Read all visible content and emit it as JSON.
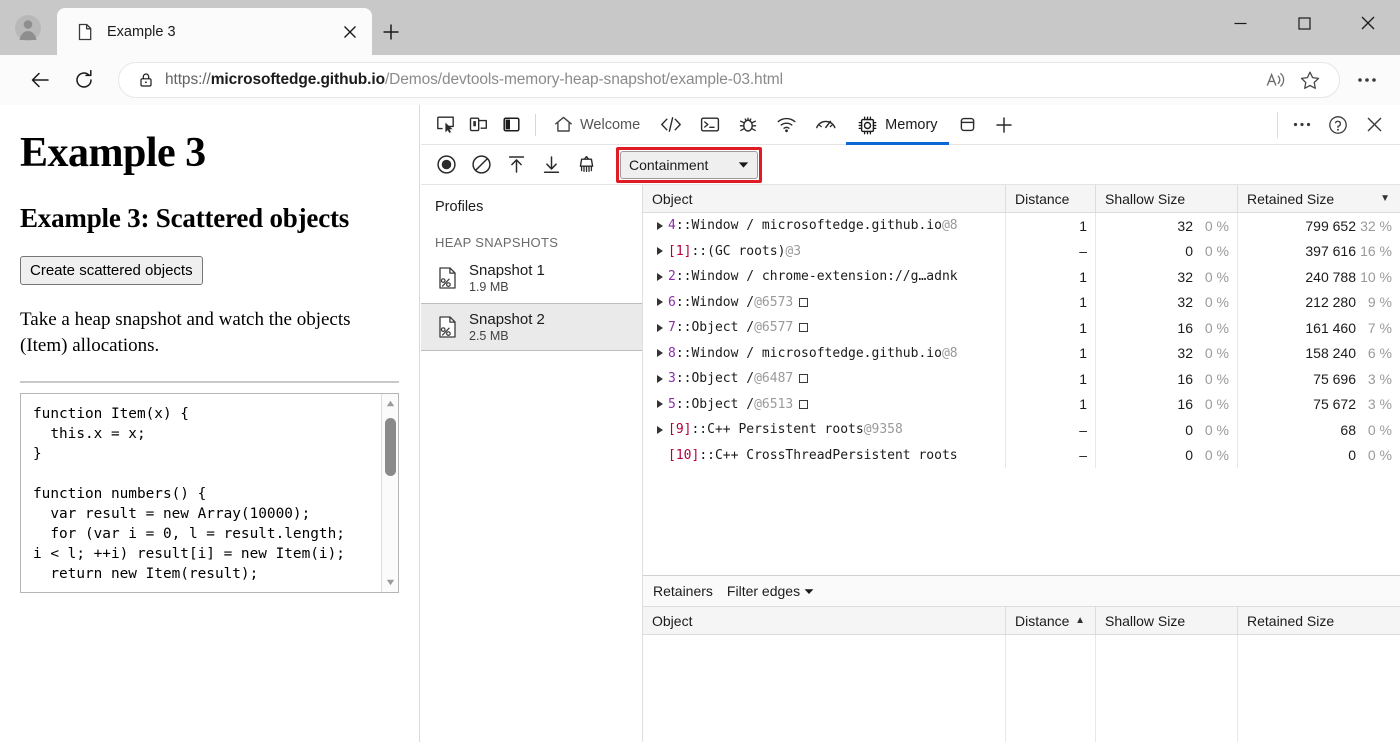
{
  "browser": {
    "tab": {
      "title": "Example 3",
      "favicon_icon": "document-icon",
      "close_icon": "close-icon"
    },
    "new_tab_icon": "plus-icon",
    "profile_icon": "account-avatar-icon",
    "window_controls": {
      "minimize": "minimize-icon",
      "maximize": "maximize-icon",
      "close": "close-icon"
    },
    "nav": {
      "back_icon": "arrow-left-icon",
      "reload_icon": "reload-icon"
    },
    "omnibox": {
      "lock_icon": "lock-icon",
      "scheme": "https://",
      "host": "microsoftedge.github.io",
      "path": "/Demos/devtools-memory-heap-snapshot/example-03.html",
      "read_aloud_icon": "read-aloud-icon",
      "favorite_icon": "star-icon"
    },
    "settings_icon": "ellipsis-icon"
  },
  "page": {
    "h1": "Example 3",
    "h2": "Example 3: Scattered objects",
    "button_label": "Create scattered objects",
    "paragraph": "Take a heap snapshot and watch the objects (Item) allocations.",
    "code": "function Item(x) {\n  this.x = x;\n}\n\nfunction numbers() {\n  var result = new Array(10000);\n  for (var i = 0, l = result.length;\ni < l; ++i) result[i] = new Item(i);\n  return new Item(result);",
    "scrollbar": {
      "up_icon": "caret-up-icon",
      "down_icon": "caret-down-icon"
    }
  },
  "devtools": {
    "left_icons": [
      {
        "name": "inspect-element-icon"
      },
      {
        "name": "device-emulation-icon"
      },
      {
        "name": "dock-side-icon"
      }
    ],
    "tabs": [
      {
        "label": "Welcome",
        "icon": "home-icon",
        "active": false
      },
      {
        "label": "",
        "icon": "elements-code-icon",
        "active": false
      },
      {
        "label": "",
        "icon": "console-terminal-icon",
        "active": false
      },
      {
        "label": "",
        "icon": "debugger-bug-icon",
        "active": false
      },
      {
        "label": "",
        "icon": "network-wifi-icon",
        "active": false
      },
      {
        "label": "",
        "icon": "performance-gauge-icon",
        "active": false
      },
      {
        "label": "Memory",
        "icon": "memory-chip-icon",
        "active": true
      },
      {
        "label": "",
        "icon": "application-storage-icon",
        "active": false
      },
      {
        "label": "",
        "icon": "plus-icon",
        "active": false
      }
    ],
    "right_buttons": [
      {
        "name": "more-options-icon"
      },
      {
        "name": "help-icon"
      },
      {
        "name": "close-devtools-icon"
      }
    ],
    "toolbar": {
      "icons": [
        {
          "name": "record-icon"
        },
        {
          "name": "clear-icon"
        },
        {
          "name": "load-profile-icon"
        },
        {
          "name": "save-profile-icon"
        },
        {
          "name": "collect-garbage-icon"
        }
      ],
      "view_select": {
        "value": "Containment",
        "chevron_icon": "chevron-down-icon",
        "highlight_color": "#e01b24"
      }
    },
    "sidebar": {
      "title": "Profiles",
      "group_label": "HEAP SNAPSHOTS",
      "snapshots": [
        {
          "name": "Snapshot 1",
          "size": "1.9 MB",
          "icon": "heap-snapshot-icon",
          "selected": false
        },
        {
          "name": "Snapshot 2",
          "size": "2.5 MB",
          "icon": "heap-snapshot-icon",
          "selected": true
        }
      ]
    },
    "grid": {
      "columns": [
        {
          "label": "Object",
          "sort": ""
        },
        {
          "label": "Distance",
          "sort": ""
        },
        {
          "label": "Shallow Size",
          "sort": ""
        },
        {
          "label": "Retained Size",
          "sort": "▼"
        }
      ],
      "rows": [
        {
          "expandable": true,
          "index": "4",
          "index_style": "purple",
          "name": "Window / microsoftedge.github.io",
          "at": "@8",
          "box": false,
          "distance": "1",
          "shallow": "32",
          "shallow_pct": "0 %",
          "retained": "799 652",
          "retained_pct": "32 %"
        },
        {
          "expandable": true,
          "index": "[1]",
          "index_style": "red",
          "name": "(GC roots)",
          "at": "@3",
          "box": false,
          "distance": "–",
          "shallow": "0",
          "shallow_pct": "0 %",
          "retained": "397 616",
          "retained_pct": "16 %"
        },
        {
          "expandable": true,
          "index": "2",
          "index_style": "purple",
          "name": "Window / chrome-extension://g…adnk",
          "at": "",
          "box": false,
          "distance": "1",
          "shallow": "32",
          "shallow_pct": "0 %",
          "retained": "240 788",
          "retained_pct": "10 %"
        },
        {
          "expandable": true,
          "index": "6",
          "index_style": "purple",
          "name": "Window /",
          "at": "@6573",
          "box": true,
          "distance": "1",
          "shallow": "32",
          "shallow_pct": "0 %",
          "retained": "212 280",
          "retained_pct": "9 %"
        },
        {
          "expandable": true,
          "index": "7",
          "index_style": "purple",
          "name": "Object /",
          "at": "@6577",
          "box": true,
          "distance": "1",
          "shallow": "16",
          "shallow_pct": "0 %",
          "retained": "161 460",
          "retained_pct": "7 %"
        },
        {
          "expandable": true,
          "index": "8",
          "index_style": "purple",
          "name": "Window / microsoftedge.github.io",
          "at": "@8",
          "box": false,
          "distance": "1",
          "shallow": "32",
          "shallow_pct": "0 %",
          "retained": "158 240",
          "retained_pct": "6 %"
        },
        {
          "expandable": true,
          "index": "3",
          "index_style": "purple",
          "name": "Object /",
          "at": "@6487",
          "box": true,
          "distance": "1",
          "shallow": "16",
          "shallow_pct": "0 %",
          "retained": "75 696",
          "retained_pct": "3 %"
        },
        {
          "expandable": true,
          "index": "5",
          "index_style": "purple",
          "name": "Object /",
          "at": "@6513",
          "box": true,
          "distance": "1",
          "shallow": "16",
          "shallow_pct": "0 %",
          "retained": "75 672",
          "retained_pct": "3 %"
        },
        {
          "expandable": true,
          "index": "[9]",
          "index_style": "red",
          "name": "C++ Persistent roots",
          "at": "@9358",
          "box": false,
          "distance": "–",
          "shallow": "0",
          "shallow_pct": "0 %",
          "retained": "68",
          "retained_pct": "0 %"
        },
        {
          "expandable": false,
          "index": "[10]",
          "index_style": "red",
          "name": "C++ CrossThreadPersistent roots",
          "at": "",
          "box": false,
          "distance": "–",
          "shallow": "0",
          "shallow_pct": "0 %",
          "retained": "0",
          "retained_pct": "0 %"
        }
      ]
    },
    "retainers": {
      "title": "Retainers",
      "filter_label": "Filter edges",
      "filter_chevron_icon": "chevron-down-icon",
      "columns": [
        {
          "label": "Object",
          "sort": ""
        },
        {
          "label": "Distance",
          "sort": "▲"
        },
        {
          "label": "Shallow Size",
          "sort": ""
        },
        {
          "label": "Retained Size",
          "sort": ""
        }
      ],
      "rows": []
    }
  }
}
